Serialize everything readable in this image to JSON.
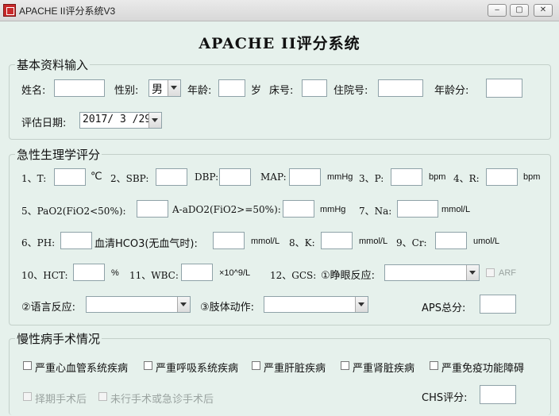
{
  "window": {
    "title": "APACHE II评分系统V3",
    "min": "‒",
    "max": "▢",
    "close": "✕"
  },
  "main_title": "APACHE II评分系统",
  "basic": {
    "legend": "基本资料输入",
    "name_label": "姓名:",
    "sex_label": "性别:",
    "sex_value": "男",
    "age_label": "年龄:",
    "age_unit": "岁",
    "bed_label": "床号:",
    "inpatient_label": "住院号:",
    "age_score_label": "年龄分:",
    "date_label": "评估日期:",
    "date_value": "2017/ 3 /29"
  },
  "acute": {
    "legend": "急性生理学评分",
    "t_label": "1、T:",
    "t_unit": "℃",
    "sbp_label": "2、SBP:",
    "dbp_label": "DBP:",
    "map_label": "MAP:",
    "map_unit": "mmHg",
    "p_label": "3、P:",
    "p_unit": "bpm",
    "r_label": "4、R:",
    "r_unit": "bpm",
    "pao2_label": "5、PaO2(FiO2<50%):",
    "aado2_label": "A-aDO2(FiO2>=50%):",
    "aado2_unit": "mmHg",
    "na_label": "7、Na:",
    "na_unit": "mmol/L",
    "ph_label": "6、PH:",
    "hco3_label": "血清HCO3(无血气时):",
    "hco3_unit": "mmol/L",
    "k_label": "8、K:",
    "k_unit": "mmol/L",
    "cr_label": "9、Cr:",
    "cr_unit": "umol/L",
    "hct_label": "10、HCT:",
    "hct_unit": "%",
    "wbc_label": "11、WBC:",
    "wbc_unit": "×10^9/L",
    "gcs_label": "12、GCS:",
    "eye_label": "①睁眼反应:",
    "arf_label": "ARF",
    "verbal_label": "②语言反应:",
    "motor_label": "③肢体动作:",
    "aps_label": "APS总分:"
  },
  "chronic": {
    "legend": "慢性病手术情况",
    "items": [
      "严重心血管系统疾病",
      "严重呼吸系统疾病",
      "严重肝脏疾病",
      "严重肾脏疾病",
      "严重免疫功能障碍"
    ],
    "surgery_items": [
      "择期手术后",
      "未行手术或急诊手术后"
    ],
    "chs_label": "CHS评分:"
  }
}
